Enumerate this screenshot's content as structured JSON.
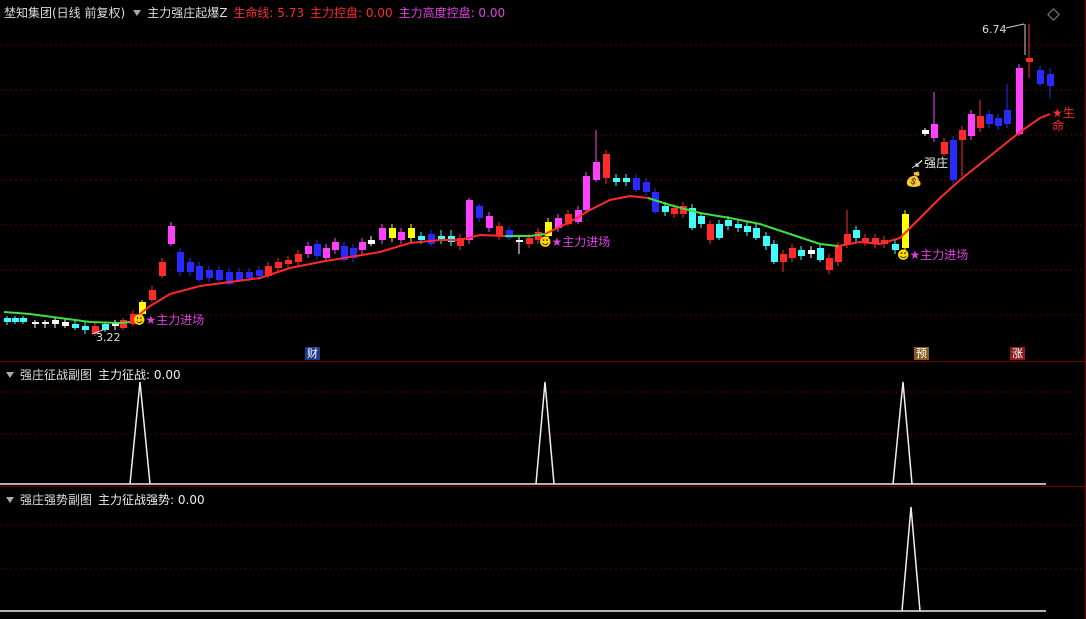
{
  "main": {
    "stock": "埜知集团(日线 前复权)",
    "indicator": "主力强庄起爆Z",
    "items": [
      {
        "label": "生命线: 5.73",
        "color": "#ff2a2a"
      },
      {
        "label": "主力控盘: 0.00",
        "color": "#ff2a2a"
      },
      {
        "label": "主力高度控盘: 0.00",
        "color": "#e040e0"
      }
    ],
    "annotations": {
      "high": "6.74",
      "low": "3.22",
      "entry": "主力进场",
      "strong": "强庄",
      "life": "生命"
    },
    "tags": {
      "cai": "财",
      "yu": "预",
      "zhang": "涨"
    }
  },
  "sub1": {
    "title": "强庄征战副图",
    "value_label": "主力征战: 0.00"
  },
  "sub2": {
    "title": "强庄强势副图",
    "value_label": "主力征战强势: 0.00"
  },
  "colors": {
    "bg": "#000000",
    "grid": "#5a0000",
    "up": "#ff2a2a",
    "down": "#2a2aff",
    "cyan": "#40ffff",
    "magenta": "#ff40ff",
    "yellow": "#ffff00",
    "green": "#40e040"
  },
  "chart_data": {
    "type": "candlestick",
    "price_high": 6.74,
    "price_low": 3.22,
    "signals": {
      "entry_bars": [
        "主力进场",
        "主力进场",
        "主力进场"
      ]
    }
  }
}
